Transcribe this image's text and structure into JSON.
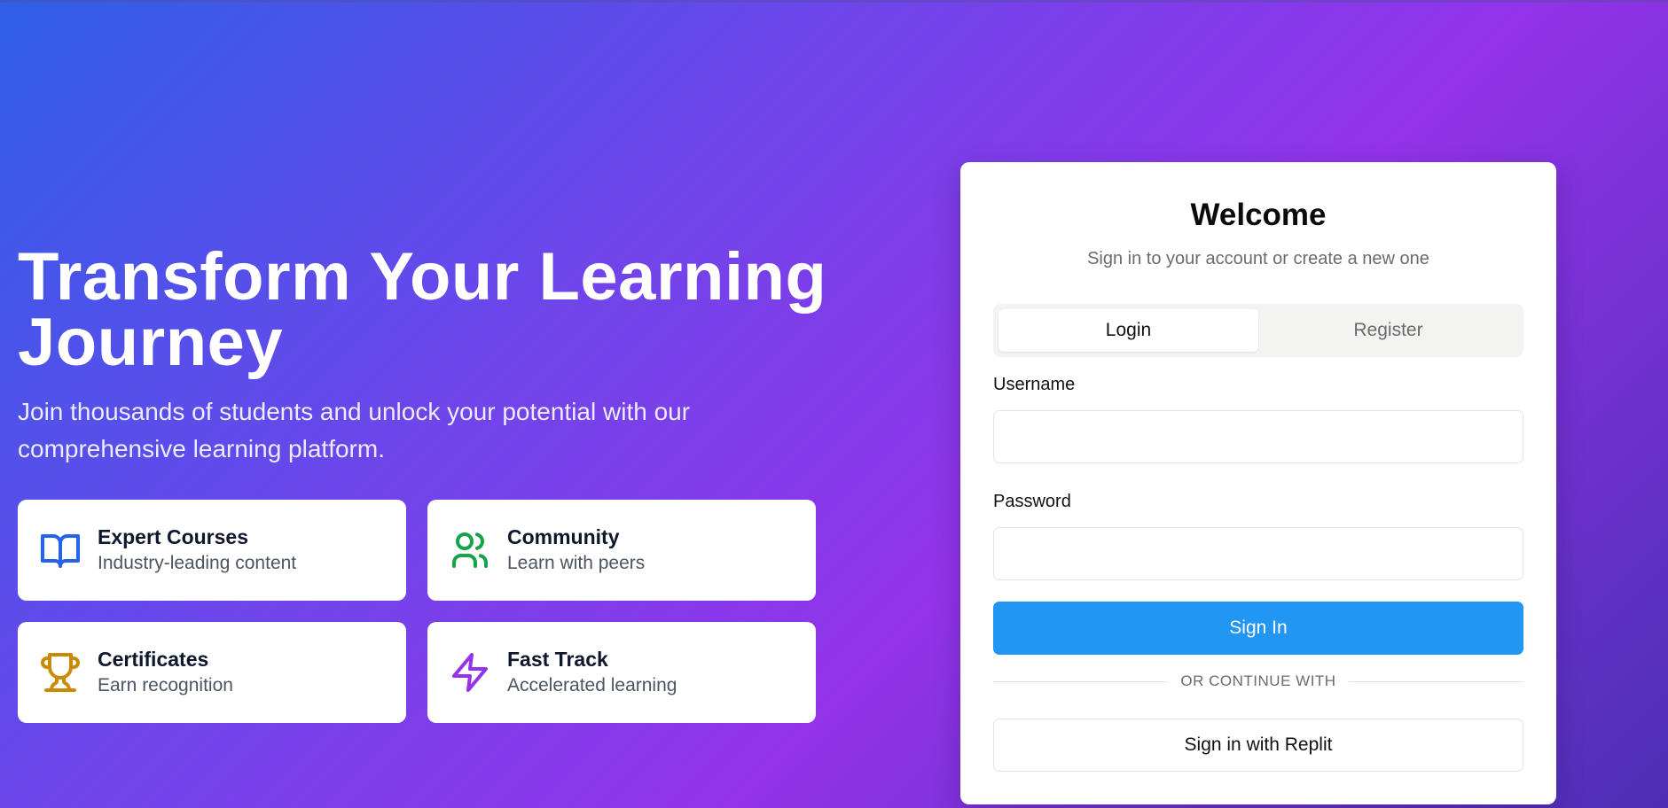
{
  "hero": {
    "title": "Transform Your Learning Journey",
    "subtitle": "Join thousands of students and unlock your potential with our comprehensive learning platform."
  },
  "features": [
    {
      "title": "Expert Courses",
      "description": "Industry-leading content",
      "icon": "book-open-icon",
      "color": "#2563eb"
    },
    {
      "title": "Community",
      "description": "Learn with peers",
      "icon": "users-icon",
      "color": "#16a34a"
    },
    {
      "title": "Certificates",
      "description": "Earn recognition",
      "icon": "trophy-icon",
      "color": "#ca8a04"
    },
    {
      "title": "Fast Track",
      "description": "Accelerated learning",
      "icon": "lightning-icon",
      "color": "#9333ea"
    }
  ],
  "auth": {
    "title": "Welcome",
    "subtitle": "Sign in to your account or create a new one",
    "tabs": [
      {
        "label": "Login",
        "active": true
      },
      {
        "label": "Register",
        "active": false
      }
    ],
    "username_label": "Username",
    "username_value": "",
    "password_label": "Password",
    "password_value": "",
    "sign_in_label": "Sign In",
    "divider_text": "OR CONTINUE WITH",
    "replit_label": "Sign in with Replit"
  },
  "colors": {
    "primary_button": "#2196f3",
    "gradient_start": "#2f5fe8",
    "gradient_mid": "#9333ea"
  }
}
